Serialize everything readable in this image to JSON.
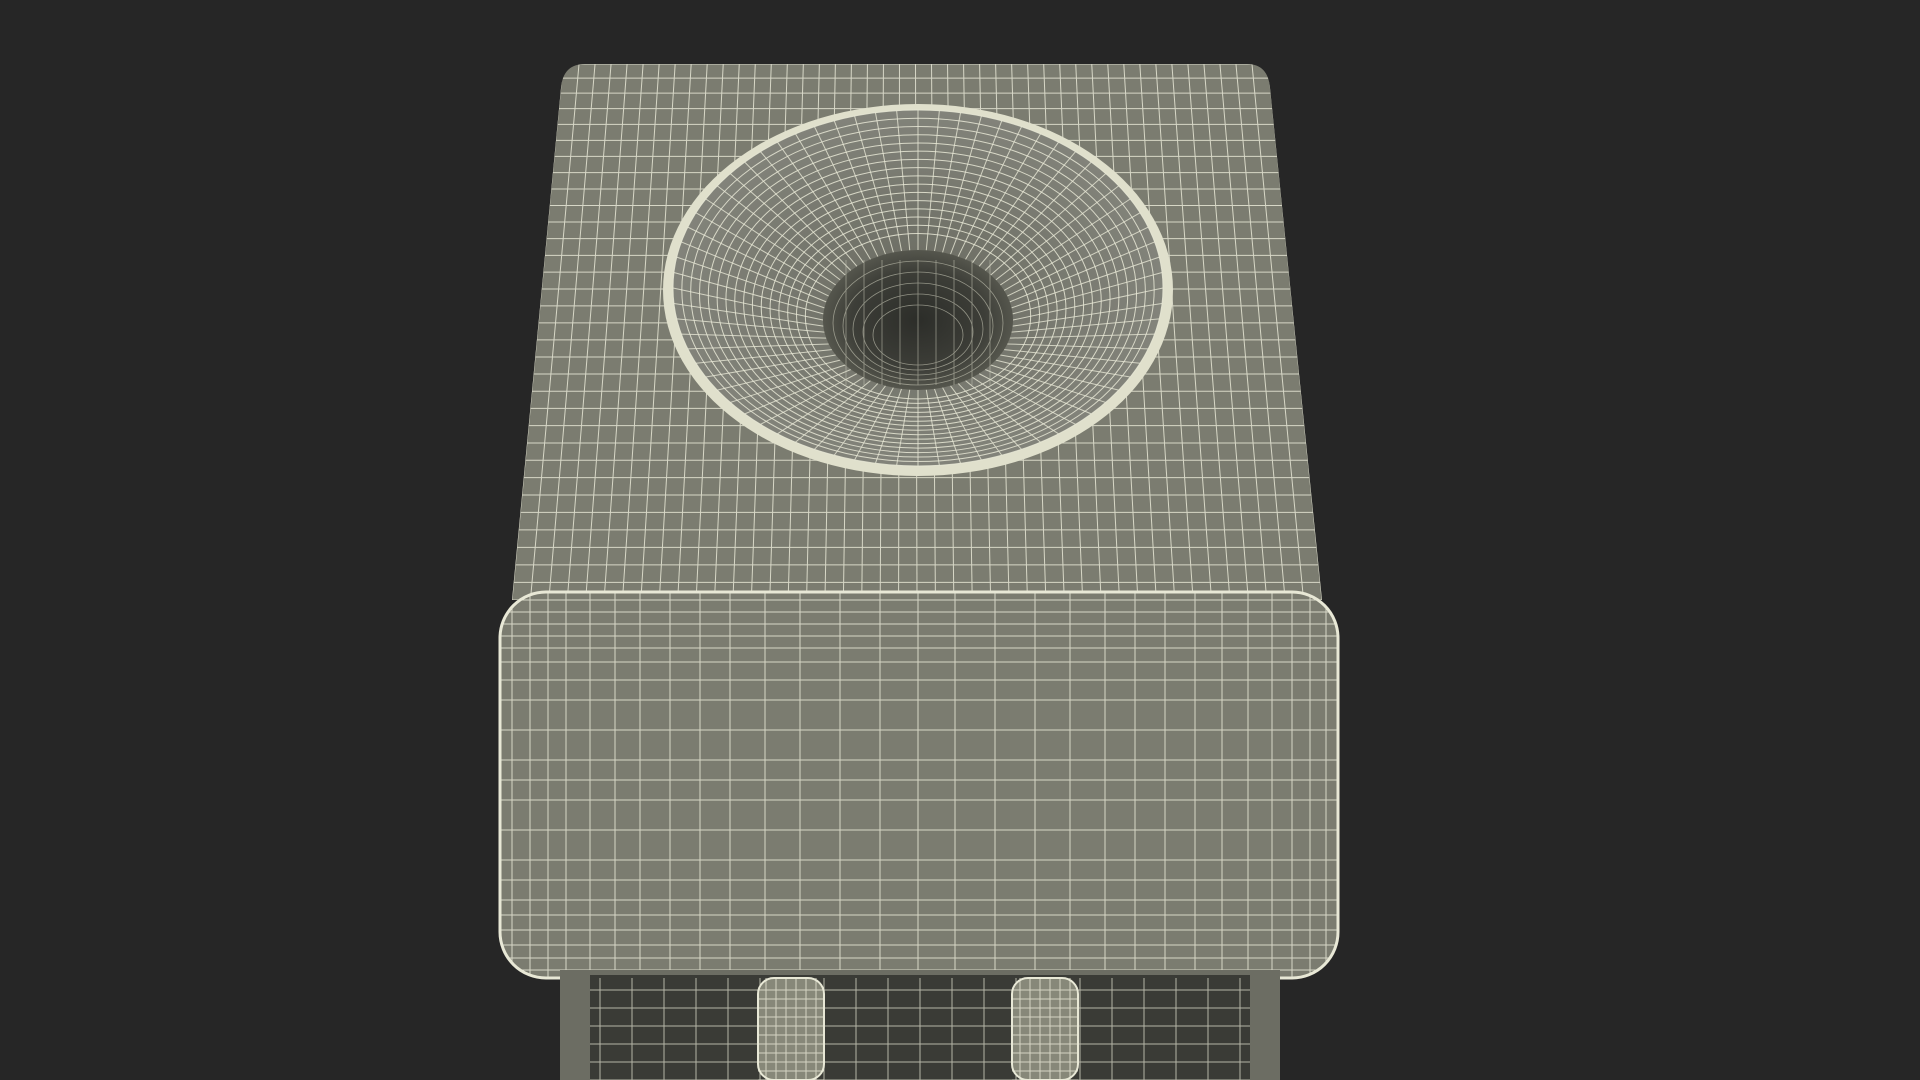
{
  "scene": {
    "background_color": "#262626",
    "mesh_fill_color": "#7b7c70",
    "mesh_shadow_color": "#5f6056",
    "wire_color": "#e8e8d6",
    "subject": "water-dispenser-wireframe-model",
    "render_style": "wireframe-over-shaded"
  }
}
